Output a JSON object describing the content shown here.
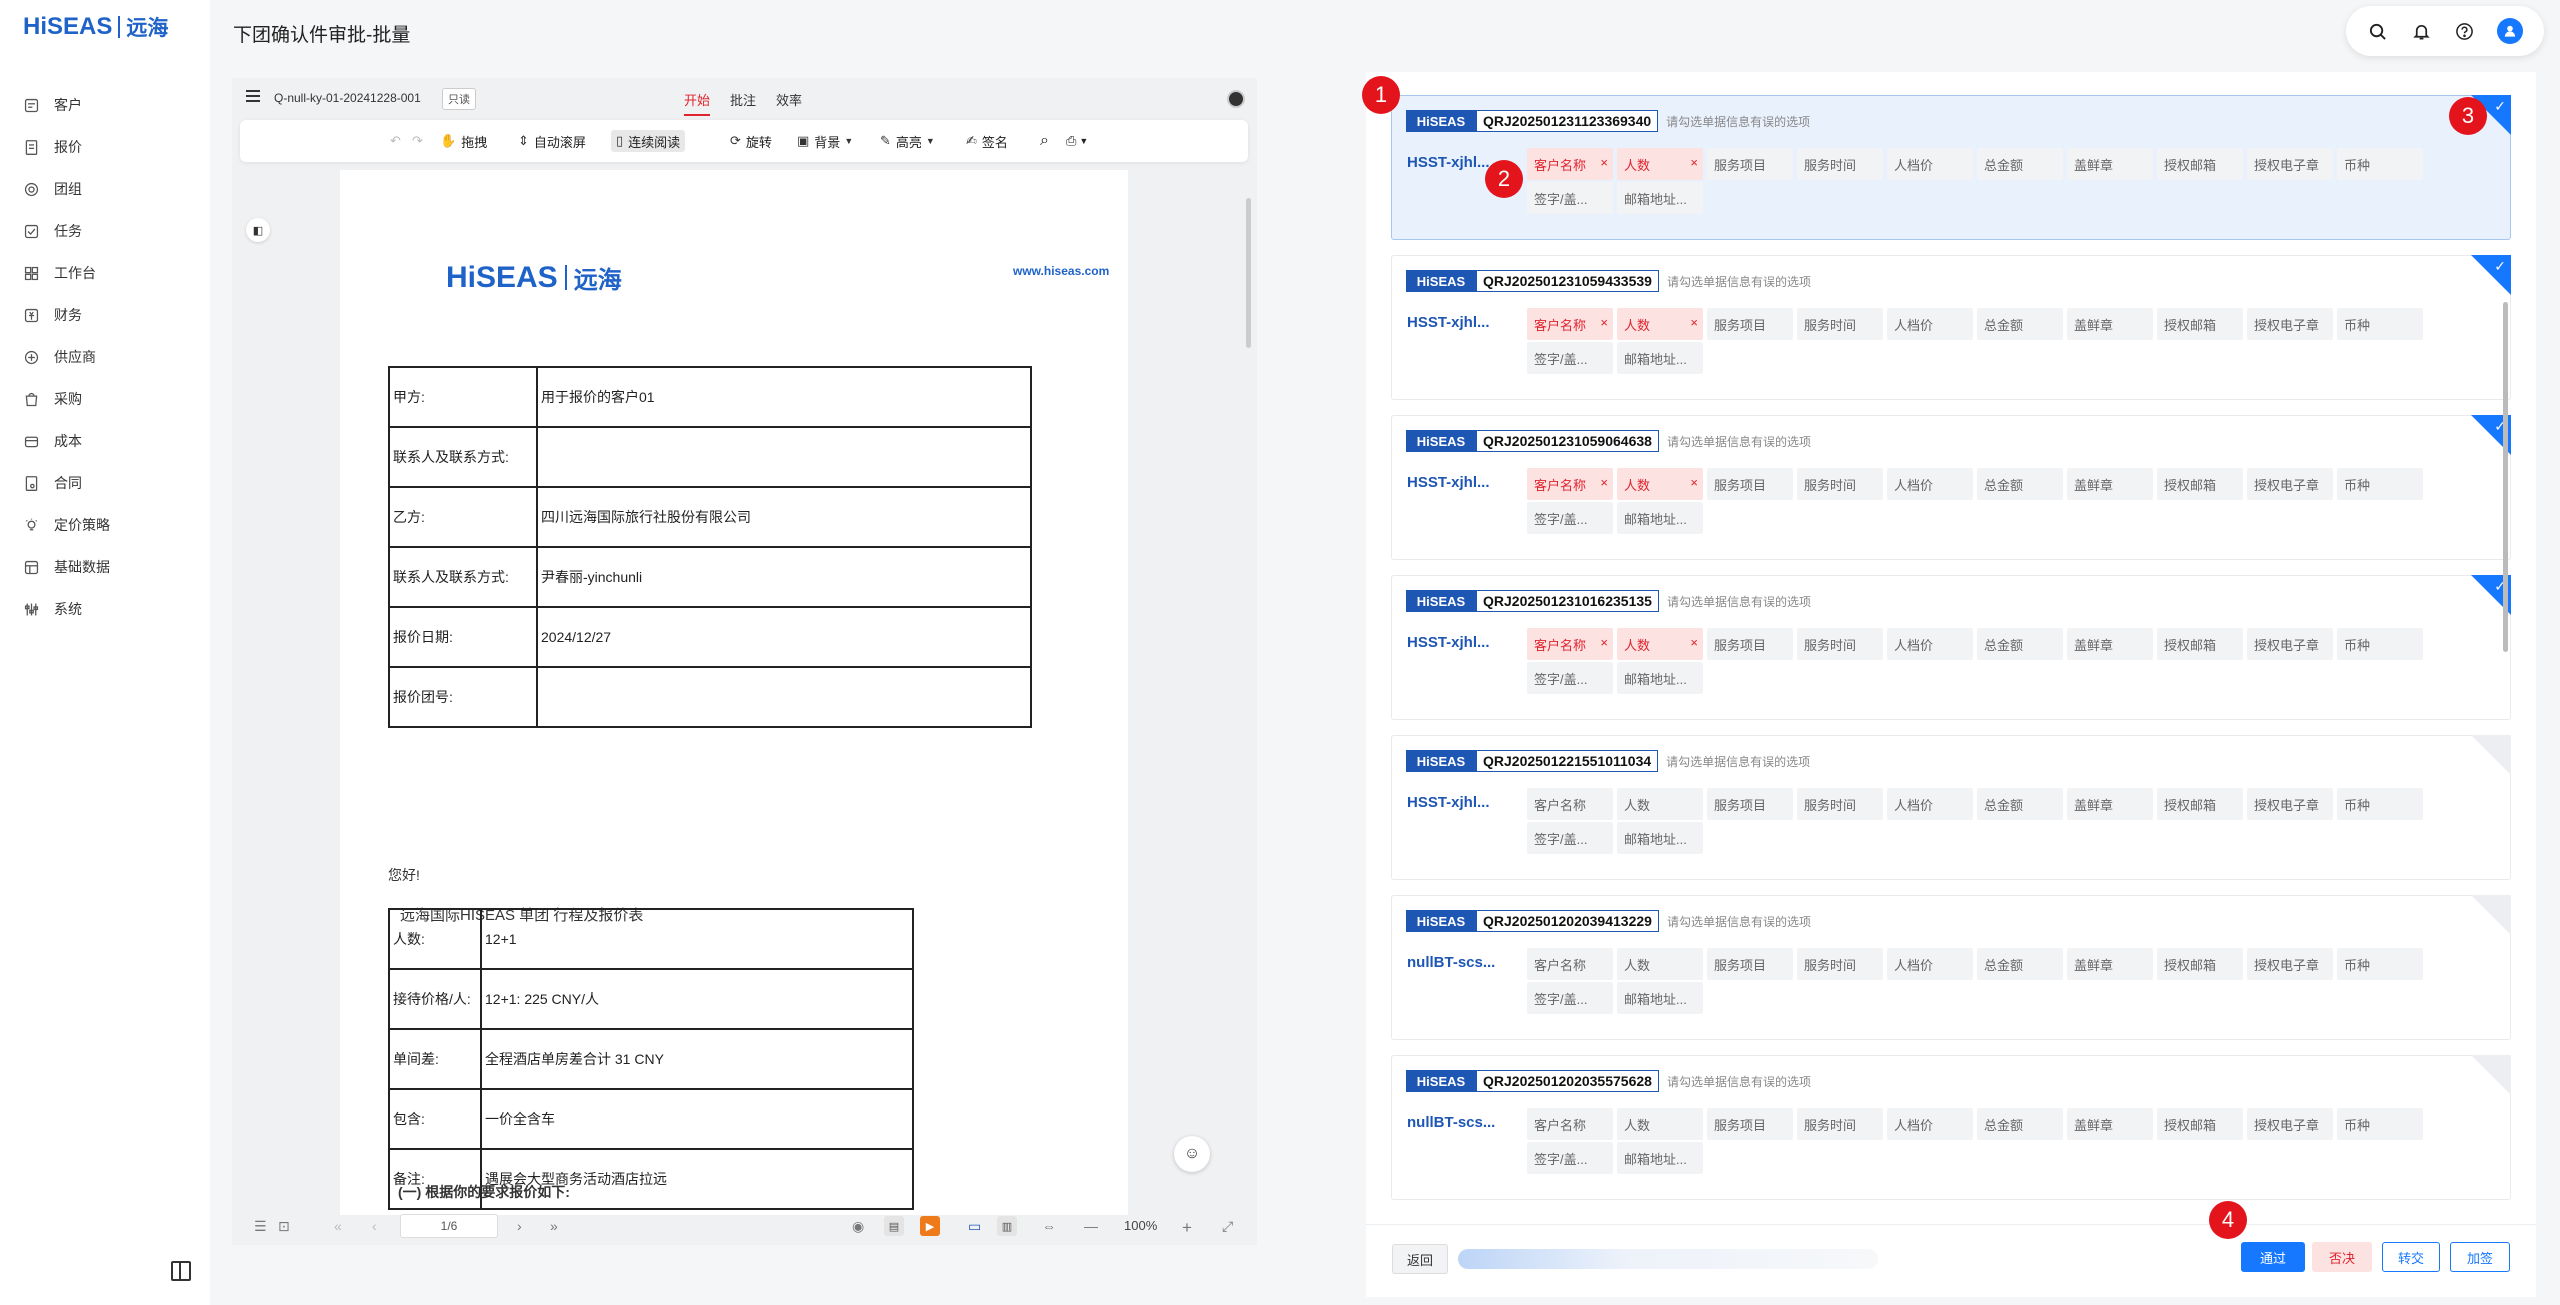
{
  "sidebar": {
    "logo_text": "HiSEAS",
    "logo_zh": "远海",
    "items": [
      {
        "label": "客户",
        "icon": "customer-icon"
      },
      {
        "label": "报价",
        "icon": "quote-icon"
      },
      {
        "label": "团组",
        "icon": "group-icon"
      },
      {
        "label": "任务",
        "icon": "task-icon"
      },
      {
        "label": "工作台",
        "icon": "workbench-icon"
      },
      {
        "label": "财务",
        "icon": "finance-icon"
      },
      {
        "label": "供应商",
        "icon": "supplier-icon"
      },
      {
        "label": "采购",
        "icon": "purchase-icon"
      },
      {
        "label": "成本",
        "icon": "cost-icon"
      },
      {
        "label": "合同",
        "icon": "contract-icon"
      },
      {
        "label": "定价策略",
        "icon": "pricing-icon"
      },
      {
        "label": "基础数据",
        "icon": "basedata-icon"
      },
      {
        "label": "系统",
        "icon": "system-icon"
      }
    ]
  },
  "header": {
    "title": "下团确认件审批-批量"
  },
  "doc": {
    "filename": "Q-null-ky-01-20241228-001",
    "readonly": "只读",
    "tabs": [
      "开始",
      "批注",
      "效率"
    ],
    "toolbar": {
      "drag": "拖拽",
      "auto_scroll": "自动滚屏",
      "continuous": "连续阅读",
      "rotate": "旋转",
      "background": "背景",
      "highlight": "高亮",
      "sign": "签名"
    },
    "page": {
      "logo_text": "HiSEAS",
      "logo_zh": "远海",
      "site": "www.hiseas.com",
      "table1": [
        [
          "甲方:",
          "用于报价的客户01"
        ],
        [
          "联系人及联系方式:",
          ""
        ],
        [
          "乙方:",
          "四川远海国际旅行社股份有限公司"
        ],
        [
          "联系人及联系方式:",
          "尹春丽-yinchunli"
        ],
        [
          "报价日期:",
          "2024/12/27"
        ],
        [
          "报价团号:",
          ""
        ]
      ],
      "greeting": "您好!",
      "intro": "远海国际HISEAS 单团 行程及报价表",
      "table2": [
        [
          "人数:",
          "12+1"
        ],
        [
          "接待价格/人:",
          "12+1:    225 CNY/人"
        ],
        [
          "单间差:",
          "全程酒店单房差合计 31 CNY"
        ],
        [
          "包含:",
          " 一价全含车"
        ],
        [
          "备注:",
          "遇展会大型商务活动酒店拉远"
        ]
      ],
      "section": "(一)  根据你的要求报价如下:"
    },
    "bottom": {
      "page": "1/6",
      "zoom": "100%"
    }
  },
  "review": {
    "hint": "请勾选单据信息有误的选项",
    "field_labels": [
      "客户名称",
      "人数",
      "服务项目",
      "服务时间",
      "人档价",
      "总金额",
      "盖鲜章",
      "授权邮箱",
      "授权电子章",
      "币种",
      "签字/盖...",
      "邮箱地址..."
    ],
    "cards": [
      {
        "code": "QRJ202501231123369340",
        "label": "HSST-xjhl...",
        "checked": true,
        "errors": true
      },
      {
        "code": "QRJ202501231059433539",
        "label": "HSST-xjhl...",
        "checked": true,
        "errors": true
      },
      {
        "code": "QRJ202501231059064638",
        "label": "HSST-xjhl...",
        "checked": true,
        "errors": true
      },
      {
        "code": "QRJ202501231016235135",
        "label": "HSST-xjhl...",
        "checked": true,
        "errors": true
      },
      {
        "code": "QRJ202501221551011034",
        "label": "HSST-xjhl...",
        "checked": false,
        "errors": false
      },
      {
        "code": "QRJ202501202039413229",
        "label": "nullBT-scs...",
        "checked": false,
        "errors": false
      },
      {
        "code": "QRJ202501202035575628",
        "label": "nullBT-scs...",
        "checked": false,
        "errors": false
      }
    ],
    "badges": [
      "1",
      "2",
      "3",
      "4"
    ],
    "footer": {
      "back": "返回",
      "pass": "通过",
      "reject": "否决",
      "transfer": "转交",
      "add_sign": "加签"
    }
  },
  "colors": {
    "brand": "#1e56b4",
    "primary": "#1677ff",
    "danger": "#e0242e"
  }
}
